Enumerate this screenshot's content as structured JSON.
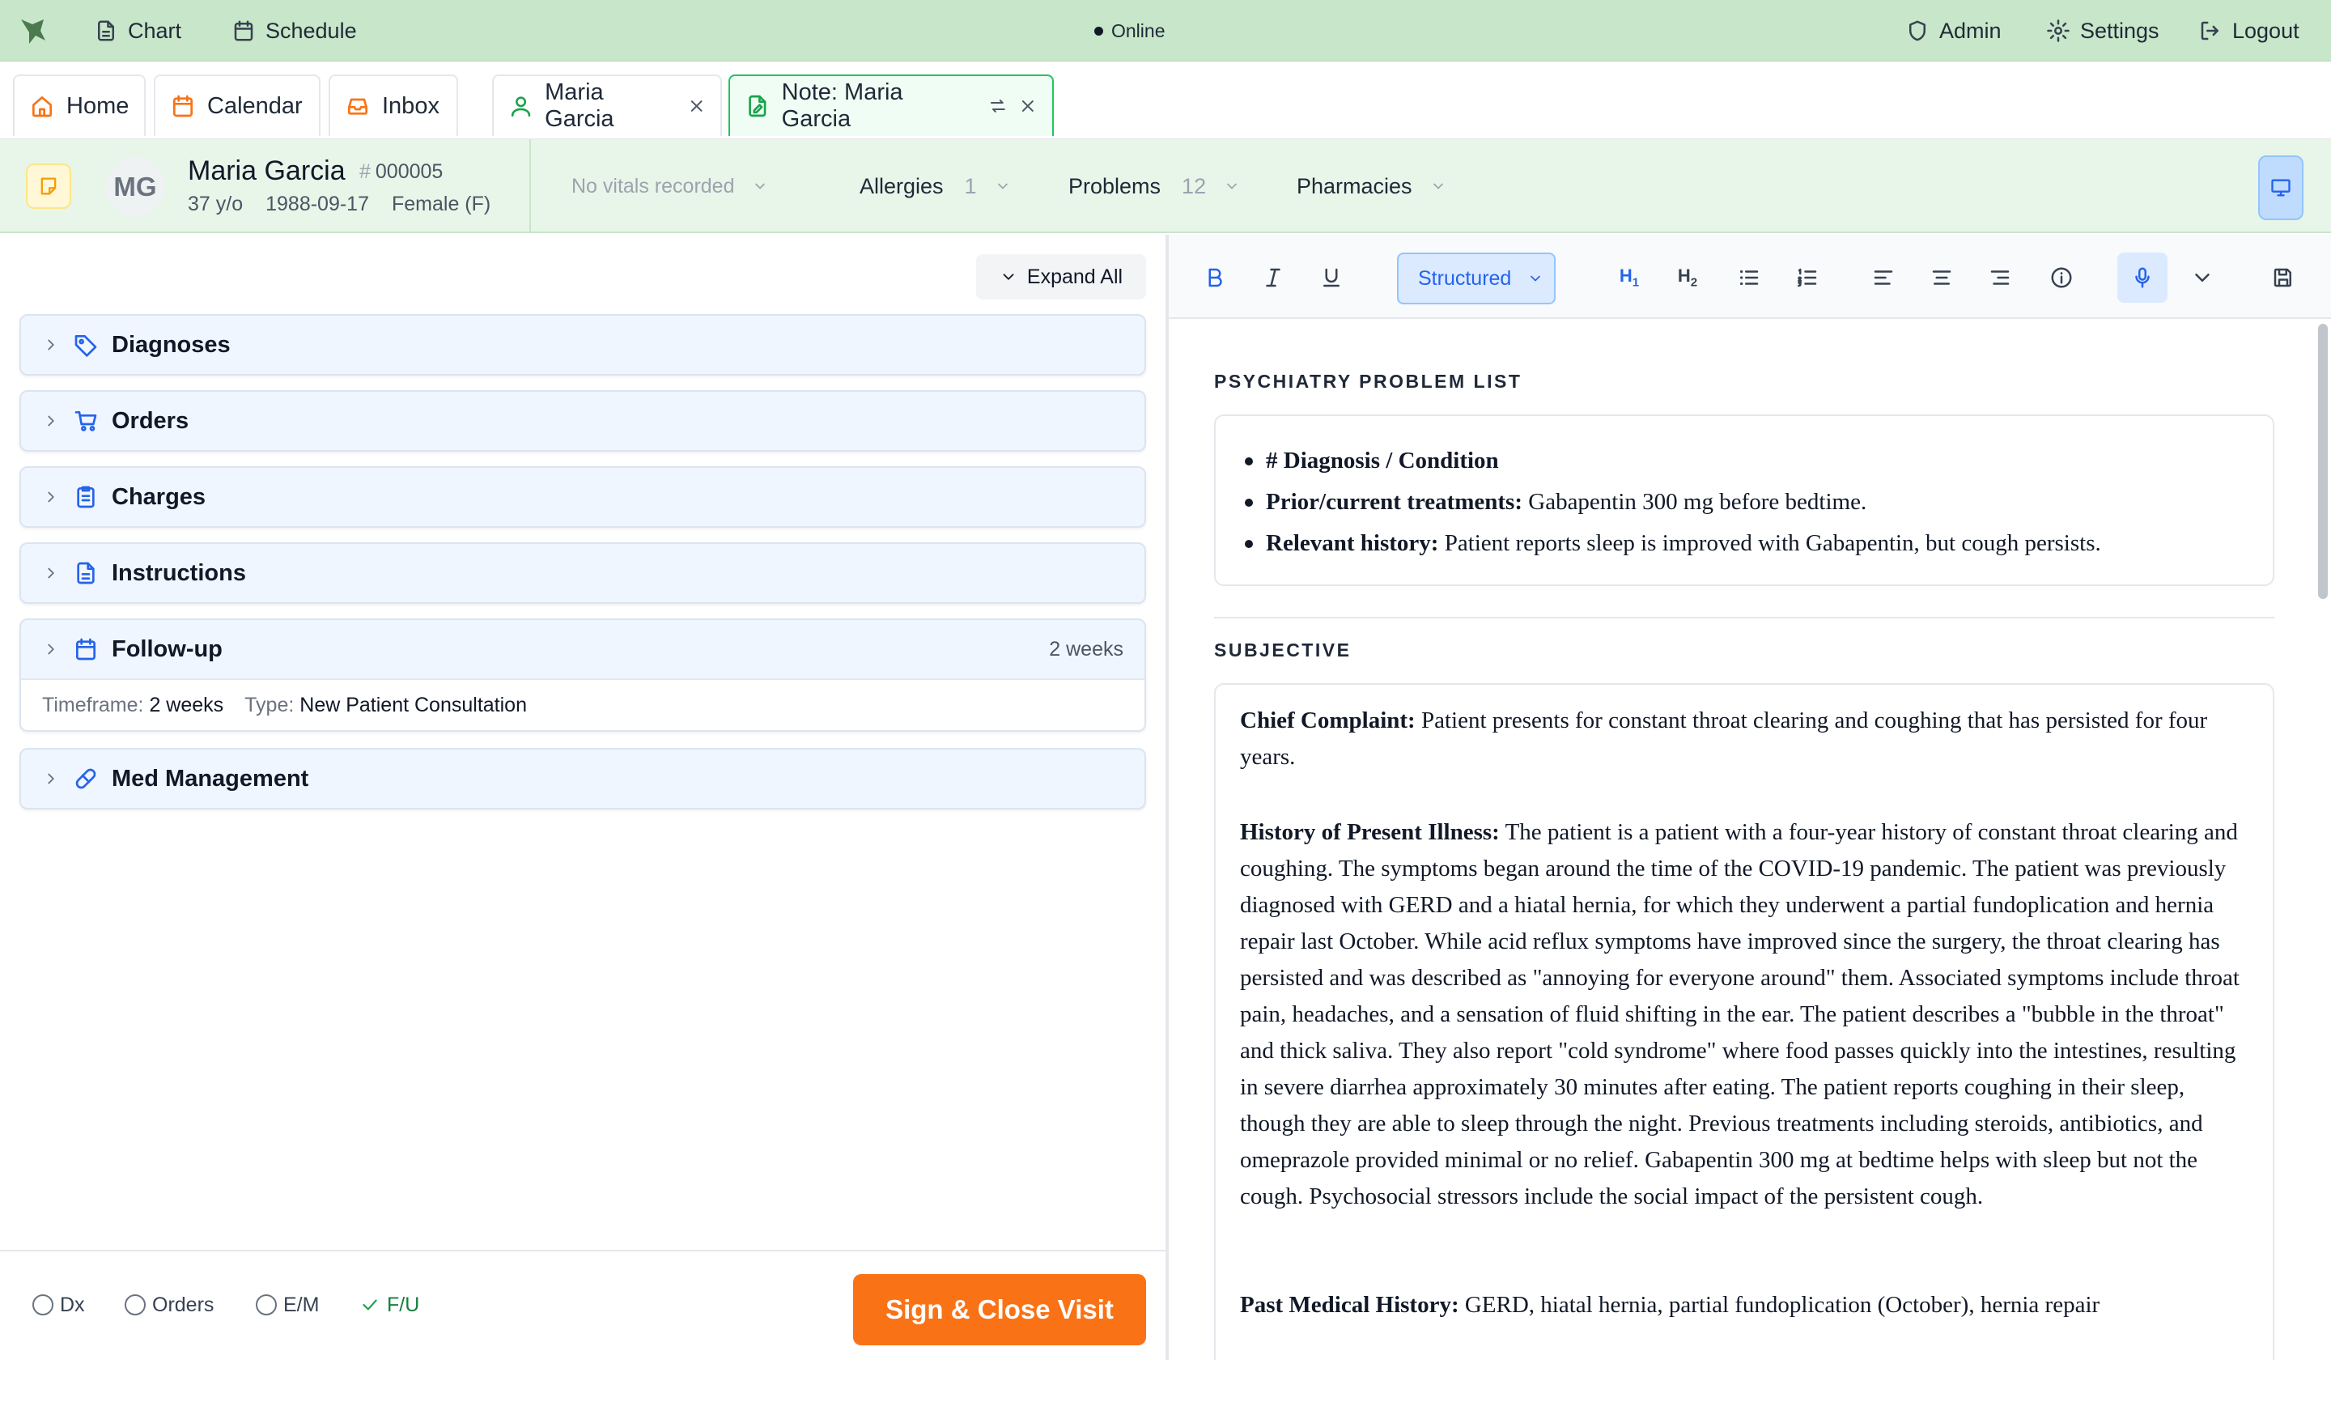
{
  "topbar": {
    "chart": "Chart",
    "schedule": "Schedule",
    "status": "Online",
    "admin": "Admin",
    "settings": "Settings",
    "logout": "Logout",
    "color": "#c8e6c9"
  },
  "tabs": [
    {
      "label": "Home",
      "icon": "home-icon"
    },
    {
      "label": "Calendar",
      "icon": "calendar-icon"
    },
    {
      "label": "Inbox",
      "icon": "inbox-icon"
    },
    {
      "label": "Maria Garcia",
      "icon": "user-icon"
    },
    {
      "label": "Note: Maria Garcia",
      "icon": "note-icon",
      "active": true
    }
  ],
  "patient": {
    "initials": "MG",
    "name": "Maria Garcia",
    "mrn": "000005",
    "age": "37 y/o",
    "dob": "1988-09-17",
    "sex": "Female (F)",
    "vitals": "No vitals recorded",
    "allergies_label": "Allergies",
    "allergies_count": "1",
    "problems_label": "Problems",
    "problems_count": "12",
    "pharmacies_label": "Pharmacies"
  },
  "left": {
    "expand_all": "Expand All",
    "sections": [
      {
        "title": "Diagnoses",
        "icon": "tag-icon"
      },
      {
        "title": "Orders",
        "icon": "cart-icon"
      },
      {
        "title": "Charges",
        "icon": "clipboard-icon"
      },
      {
        "title": "Instructions",
        "icon": "document-icon"
      },
      {
        "title": "Follow-up",
        "icon": "calendar-icon",
        "summary": "2 weeks",
        "timeframe_label": "Timeframe:",
        "timeframe": "2 weeks",
        "type_label": "Type:",
        "type": "New Patient Consultation"
      },
      {
        "title": "Med Management",
        "icon": "pill-icon"
      }
    ],
    "footer": {
      "checks": [
        {
          "label": "Dx",
          "done": false
        },
        {
          "label": "Orders",
          "done": false
        },
        {
          "label": "E/M",
          "done": false
        },
        {
          "label": "F/U",
          "done": true
        }
      ],
      "sign_button": "Sign & Close Visit",
      "sign_color": "#f97316"
    }
  },
  "editor": {
    "format": "Structured",
    "h1": "H",
    "h1_sub": "1",
    "h2": "H",
    "h2_sub": "2",
    "problem_list_heading": "PSYCHIATRY PROBLEM LIST",
    "problem_items": [
      {
        "label": "# Diagnosis / Condition",
        "text": ""
      },
      {
        "label": "Prior/current treatments:",
        "text": " Gabapentin 300 mg before bedtime."
      },
      {
        "label": "Relevant history:",
        "text": " Patient reports sleep is improved with Gabapentin, but cough persists."
      }
    ],
    "subjective_heading": "SUBJECTIVE",
    "chief_complaint_label": "Chief Complaint:",
    "chief_complaint": " Patient presents for constant throat clearing and coughing that has persisted for four years.",
    "hpi_label": "History of Present Illness:",
    "hpi": " The patient is a patient with a four-year history of constant throat clearing and coughing. The symptoms began around the time of the COVID-19 pandemic. The patient was previously diagnosed with GERD and a hiatal hernia, for which they underwent a partial fundoplication and hernia repair last October. While acid reflux symptoms have improved since the surgery, the throat clearing has persisted and was described as \"annoying for everyone around\" them. Associated symptoms include throat pain, headaches, and a sensation of fluid shifting in the ear. The patient describes a \"bubble in the throat\" and thick saliva. They also report \"cold syndrome\" where food passes quickly into the intestines, resulting in severe diarrhea approximately 30 minutes after eating. The patient reports coughing in their sleep, though they are able to sleep through the night. Previous treatments including steroids, antibiotics, and omeprazole provided minimal or no relief. Gabapentin 300 mg at bedtime helps with sleep but not the cough. Psychosocial stressors include the social impact of the persistent cough.",
    "pmh_label": "Past Medical History:",
    "pmh": " GERD, hiatal hernia, partial fundoplication (October), hernia repair"
  }
}
